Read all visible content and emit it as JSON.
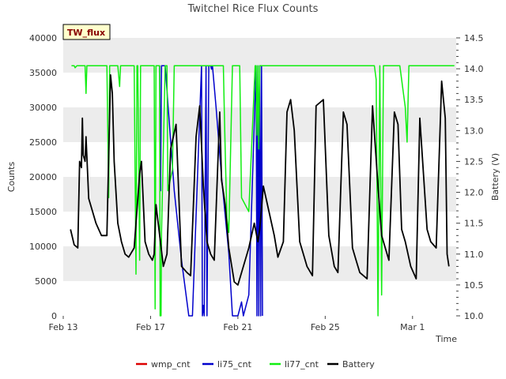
{
  "chart_data": {
    "type": "line",
    "title": "Twitchel Rice Flux Counts",
    "badge": "TW_flux",
    "xlabel": "Time",
    "ylabel": "Counts",
    "y2label": "Battery (V)",
    "xlim": [
      "2021-02-13",
      "2021-03-03"
    ],
    "x_ticks": [
      {
        "date": "2021-02-13",
        "label": "Feb 13"
      },
      {
        "date": "2021-02-17",
        "label": "Feb 17"
      },
      {
        "date": "2021-02-21",
        "label": "Feb 21"
      },
      {
        "date": "2021-02-25",
        "label": "Feb 25"
      },
      {
        "date": "2021-03-01",
        "label": "Mar 1"
      }
    ],
    "ylim": [
      0,
      40000
    ],
    "y_ticks": [
      0,
      5000,
      10000,
      15000,
      20000,
      25000,
      30000,
      35000,
      40000
    ],
    "y2lim": [
      10.0,
      14.5
    ],
    "y2_ticks": [
      10.0,
      10.5,
      11.0,
      11.5,
      12.0,
      12.5,
      13.0,
      13.5,
      14.0,
      14.5
    ],
    "grid": "horizontal bands",
    "legend_position": "bottom",
    "colors": {
      "wmp_cnt": "#dd0000",
      "li75_cnt": "#0000cc",
      "li77_cnt": "#11ee11",
      "Battery": "#000000",
      "band": "#ececec",
      "badge_bg": "#ffffcc",
      "badge_text": "#880000"
    },
    "series": [
      {
        "name": "wmp_cnt",
        "axis": "left",
        "x": [],
        "y": []
      },
      {
        "name": "li75_cnt",
        "axis": "left",
        "x": [
          "2021-02-17 10:00",
          "2021-02-17 11:00",
          "2021-02-17 12:00",
          "2021-02-17 13:00",
          "2021-02-17 14:00",
          "2021-02-17 16:00",
          "2021-02-18 02:00",
          "2021-02-18 10:00",
          "2021-02-18 18:00",
          "2021-02-18 22:00",
          "2021-02-19 08:00",
          "2021-02-19 09:00",
          "2021-02-19 10:00",
          "2021-02-19 11:00",
          "2021-02-19 13:00",
          "2021-02-19 14:00",
          "2021-02-19 16:00",
          "2021-02-19 18:00",
          "2021-02-19 19:00",
          "2021-02-19 20:00",
          "2021-02-20 00:00",
          "2021-02-20 06:00",
          "2021-02-20 14:00",
          "2021-02-20 18:00",
          "2021-02-21 00:00",
          "2021-02-21 04:00",
          "2021-02-21 06:00",
          "2021-02-21 12:00",
          "2021-02-21 20:00",
          "2021-02-21 21:00",
          "2021-02-21 22:00",
          "2021-02-21 23:00",
          "2021-02-22 00:00",
          "2021-02-22 01:00",
          "2021-02-22 02:00",
          "2021-02-22 03:00"
        ],
        "y": [
          36000,
          18000,
          36000,
          36000,
          36000,
          36000,
          18000,
          8000,
          0,
          0,
          36000,
          0,
          1500,
          0,
          36000,
          0,
          36000,
          36000,
          35500,
          36000,
          30000,
          20000,
          9000,
          0,
          0,
          2000,
          0,
          3000,
          36000,
          0,
          36000,
          0,
          36000,
          0,
          36000,
          0
        ]
      },
      {
        "name": "li77_cnt",
        "axis": "left",
        "x": [
          "2021-02-13 09:00",
          "2021-02-13 12:00",
          "2021-02-13 13:00",
          "2021-02-13 15:00",
          "2021-02-14 00:00",
          "2021-02-14 01:00",
          "2021-02-14 02:00",
          "2021-02-14 04:00",
          "2021-02-14 06:00",
          "2021-02-15 00:00",
          "2021-02-15 02:00",
          "2021-02-15 03:00",
          "2021-02-15 08:00",
          "2021-02-15 12:00",
          "2021-02-15 14:00",
          "2021-02-15 15:00",
          "2021-02-16 00:00",
          "2021-02-16 06:00",
          "2021-02-16 08:00",
          "2021-02-16 09:00",
          "2021-02-16 10:00",
          "2021-02-16 12:00",
          "2021-02-16 13:00",
          "2021-02-16 14:00",
          "2021-02-16 16:00",
          "2021-02-17 00:00",
          "2021-02-17 04:00",
          "2021-02-17 05:00",
          "2021-02-17 06:00",
          "2021-02-17 10:00",
          "2021-02-17 10:30",
          "2021-02-17 11:00",
          "2021-02-17 11:30",
          "2021-02-17 12:00",
          "2021-02-17 16:00",
          "2021-02-17 17:00",
          "2021-02-17 18:00",
          "2021-02-17 19:00",
          "2021-02-18 00:00",
          "2021-02-18 02:00",
          "2021-02-18 18:00",
          "2021-02-18 19:00",
          "2021-02-19 00:00",
          "2021-02-19 12:00",
          "2021-02-20 00:00",
          "2021-02-20 08:00",
          "2021-02-20 09:00",
          "2021-02-20 10:00",
          "2021-02-20 11:00",
          "2021-02-20 12:00",
          "2021-02-20 14:00",
          "2021-02-20 18:00",
          "2021-02-21 00:00",
          "2021-02-21 02:00",
          "2021-02-21 04:00",
          "2021-02-21 12:00",
          "2021-02-21 19:00",
          "2021-02-21 20:00",
          "2021-02-21 21:00",
          "2021-02-21 22:00",
          "2021-02-21 23:00",
          "2021-02-22 00:00",
          "2021-02-22 01:00",
          "2021-02-22 02:00",
          "2021-02-22 03:00",
          "2021-02-22 06:00",
          "2021-02-23 00:00",
          "2021-02-24 00:00",
          "2021-02-25 00:00",
          "2021-02-26 00:00",
          "2021-02-26 04:00",
          "2021-02-26 06:00",
          "2021-02-26 12:00",
          "2021-02-27 00:00",
          "2021-02-27 06:00",
          "2021-02-27 08:00",
          "2021-02-27 10:00",
          "2021-02-27 12:00",
          "2021-02-27 14:00",
          "2021-02-27 16:00",
          "2021-02-27 18:00",
          "2021-02-27 20:00",
          "2021-02-28 00:00",
          "2021-02-28 08:00",
          "2021-02-28 10:00",
          "2021-02-28 16:00",
          "2021-02-28 18:00",
          "2021-02-28 20:00",
          "2021-02-28 22:00",
          "2021-03-01 00:00",
          "2021-03-01 12:00",
          "2021-03-01 16:00",
          "2021-03-02 00:00",
          "2021-03-02 12:00",
          "2021-03-02 22:00"
        ],
        "y": [
          36000,
          36000,
          35700,
          36000,
          36000,
          32000,
          36000,
          36000,
          36000,
          36000,
          17000,
          36000,
          36000,
          36000,
          33000,
          36000,
          36000,
          36000,
          6000,
          36000,
          36000,
          8000,
          36000,
          36000,
          36000,
          36000,
          36000,
          1000,
          36000,
          36000,
          0,
          3000,
          0,
          12000,
          36000,
          36000,
          36000,
          18000,
          21000,
          36000,
          36000,
          36000,
          36000,
          36000,
          36000,
          36000,
          30000,
          24000,
          19000,
          14000,
          12000,
          36000,
          36000,
          36000,
          17000,
          15000,
          36000,
          36000,
          26000,
          36000,
          24000,
          36000,
          36000,
          36000,
          36000,
          36000,
          36000,
          36000,
          36000,
          36000,
          36000,
          36000,
          36000,
          36000,
          36000,
          34000,
          0,
          36000,
          3000,
          36000,
          36000,
          36000,
          36000,
          36000,
          36000,
          30000,
          25000,
          36000,
          36000,
          36000,
          36000,
          36000,
          36000,
          36000,
          36000
        ]
      },
      {
        "name": "Battery",
        "axis": "right",
        "x": [
          "2021-02-13 08:00",
          "2021-02-13 12:00",
          "2021-02-13 16:00",
          "2021-02-13 18:00",
          "2021-02-13 20:00",
          "2021-02-13 21:00",
          "2021-02-13 22:00",
          "2021-02-14 00:00",
          "2021-02-14 01:00",
          "2021-02-14 04:00",
          "2021-02-14 08:00",
          "2021-02-14 12:00",
          "2021-02-14 18:00",
          "2021-02-15 00:00",
          "2021-02-15 04:00",
          "2021-02-15 06:00",
          "2021-02-15 08:00",
          "2021-02-15 12:00",
          "2021-02-15 16:00",
          "2021-02-15 20:00",
          "2021-02-16 00:00",
          "2021-02-16 06:00",
          "2021-02-16 12:00",
          "2021-02-16 14:00",
          "2021-02-16 18:00",
          "2021-02-16 22:00",
          "2021-02-17 02:00",
          "2021-02-17 04:00",
          "2021-02-17 06:00",
          "2021-02-17 14:00",
          "2021-02-17 18:00",
          "2021-02-17 22:00",
          "2021-02-18 04:00",
          "2021-02-18 10:00",
          "2021-02-18 16:00",
          "2021-02-18 20:00",
          "2021-02-19 02:00",
          "2021-02-19 06:00",
          "2021-02-19 10:00",
          "2021-02-19 14:00",
          "2021-02-19 18:00",
          "2021-02-19 22:00",
          "2021-02-20 04:00",
          "2021-02-20 06:00",
          "2021-02-20 10:00",
          "2021-02-20 14:00",
          "2021-02-20 20:00",
          "2021-02-21 00:00",
          "2021-02-21 04:00",
          "2021-02-21 12:00",
          "2021-02-21 18:00",
          "2021-02-21 22:00",
          "2021-02-22 00:00",
          "2021-02-22 04:00",
          "2021-02-22 10:00",
          "2021-02-22 16:00",
          "2021-02-22 20:00",
          "2021-02-23 02:00",
          "2021-02-23 06:00",
          "2021-02-23 10:00",
          "2021-02-23 14:00",
          "2021-02-23 20:00",
          "2021-02-24 00:00",
          "2021-02-24 04:00",
          "2021-02-24 10:00",
          "2021-02-24 14:00",
          "2021-02-24 22:00",
          "2021-02-25 04:00",
          "2021-02-25 10:00",
          "2021-02-25 14:00",
          "2021-02-25 20:00",
          "2021-02-26 00:00",
          "2021-02-26 06:00",
          "2021-02-26 10:00",
          "2021-02-26 14:00",
          "2021-02-26 22:00",
          "2021-02-27 04:00",
          "2021-02-27 10:00",
          "2021-02-27 14:00",
          "2021-02-27 18:00",
          "2021-02-27 22:00",
          "2021-02-28 04:00",
          "2021-02-28 08:00",
          "2021-02-28 12:00",
          "2021-02-28 16:00",
          "2021-02-28 22:00",
          "2021-03-01 04:00",
          "2021-03-01 08:00",
          "2021-03-01 12:00",
          "2021-03-01 16:00",
          "2021-03-01 20:00",
          "2021-03-02 02:00",
          "2021-03-02 08:00",
          "2021-03-02 12:00",
          "2021-03-02 14:00",
          "2021-03-02 16:00"
        ],
        "y": [
          11.4,
          11.15,
          11.1,
          12.5,
          12.4,
          13.2,
          12.6,
          12.5,
          12.9,
          11.9,
          11.7,
          11.5,
          11.3,
          11.3,
          13.9,
          13.6,
          12.5,
          11.5,
          11.2,
          11.0,
          10.95,
          11.1,
          12.3,
          12.5,
          11.2,
          11.0,
          10.9,
          11.0,
          11.8,
          10.8,
          11.0,
          12.7,
          13.1,
          10.8,
          10.7,
          10.65,
          12.9,
          13.4,
          12.1,
          11.2,
          11.0,
          10.9,
          13.3,
          12.2,
          11.8,
          11.1,
          10.55,
          10.5,
          10.7,
          11.1,
          11.5,
          11.2,
          11.4,
          12.1,
          11.7,
          11.3,
          10.95,
          11.2,
          13.3,
          13.5,
          13.0,
          11.2,
          11.0,
          10.8,
          10.65,
          13.4,
          13.5,
          11.3,
          10.8,
          10.7,
          13.3,
          13.1,
          11.1,
          10.9,
          10.7,
          10.6,
          13.4,
          12.1,
          11.3,
          11.1,
          10.9,
          13.3,
          13.1,
          11.4,
          11.2,
          10.8,
          10.6,
          13.2,
          12.3,
          11.4,
          11.2,
          11.1,
          13.8,
          13.2,
          11.0,
          10.8
        ]
      }
    ]
  }
}
